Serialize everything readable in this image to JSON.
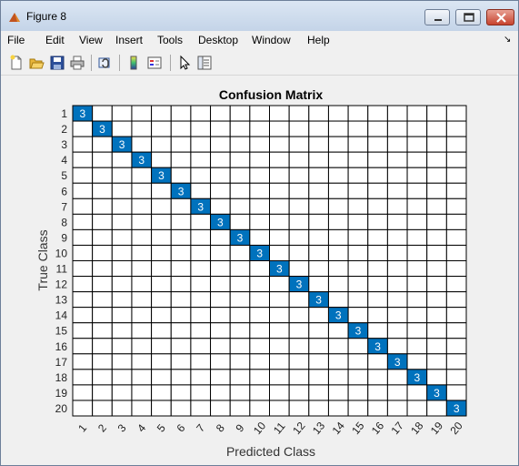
{
  "window": {
    "title": "Figure 8"
  },
  "menu": {
    "items": [
      "File",
      "Edit",
      "View",
      "Insert",
      "Tools",
      "Desktop",
      "Window",
      "Help"
    ]
  },
  "toolbar": {
    "icons": [
      "new-figure-icon",
      "open-file-icon",
      "save-icon",
      "print-icon",
      "link-plot-icon",
      "insert-colorbar-icon",
      "insert-legend-icon",
      "edit-plot-pointer-icon",
      "property-inspector-icon"
    ]
  },
  "colors": {
    "diagonal_cell": "#0072BD",
    "cell_text_on_blue": "#ffffff",
    "grid": "#000000"
  },
  "chart_data": {
    "type": "heatmap",
    "title": "Confusion Matrix",
    "xlabel": "Predicted Class",
    "ylabel": "True Class",
    "classes": [
      "1",
      "2",
      "3",
      "4",
      "5",
      "6",
      "7",
      "8",
      "9",
      "10",
      "11",
      "12",
      "13",
      "14",
      "15",
      "16",
      "17",
      "18",
      "19",
      "20"
    ],
    "nonzero_cells": [
      {
        "true": "1",
        "predicted": "1",
        "value": 3
      },
      {
        "true": "2",
        "predicted": "2",
        "value": 3
      },
      {
        "true": "3",
        "predicted": "3",
        "value": 3
      },
      {
        "true": "4",
        "predicted": "4",
        "value": 3
      },
      {
        "true": "5",
        "predicted": "5",
        "value": 3
      },
      {
        "true": "6",
        "predicted": "6",
        "value": 3
      },
      {
        "true": "7",
        "predicted": "7",
        "value": 3
      },
      {
        "true": "8",
        "predicted": "8",
        "value": 3
      },
      {
        "true": "9",
        "predicted": "9",
        "value": 3
      },
      {
        "true": "10",
        "predicted": "10",
        "value": 3
      },
      {
        "true": "11",
        "predicted": "11",
        "value": 3
      },
      {
        "true": "12",
        "predicted": "12",
        "value": 3
      },
      {
        "true": "13",
        "predicted": "13",
        "value": 3
      },
      {
        "true": "14",
        "predicted": "14",
        "value": 3
      },
      {
        "true": "15",
        "predicted": "15",
        "value": 3
      },
      {
        "true": "16",
        "predicted": "16",
        "value": 3
      },
      {
        "true": "17",
        "predicted": "17",
        "value": 3
      },
      {
        "true": "18",
        "predicted": "18",
        "value": 3
      },
      {
        "true": "19",
        "predicted": "19",
        "value": 3
      },
      {
        "true": "20",
        "predicted": "20",
        "value": 3
      }
    ],
    "off_diagonal_value": 0,
    "x_tick_rotation": "angled"
  }
}
